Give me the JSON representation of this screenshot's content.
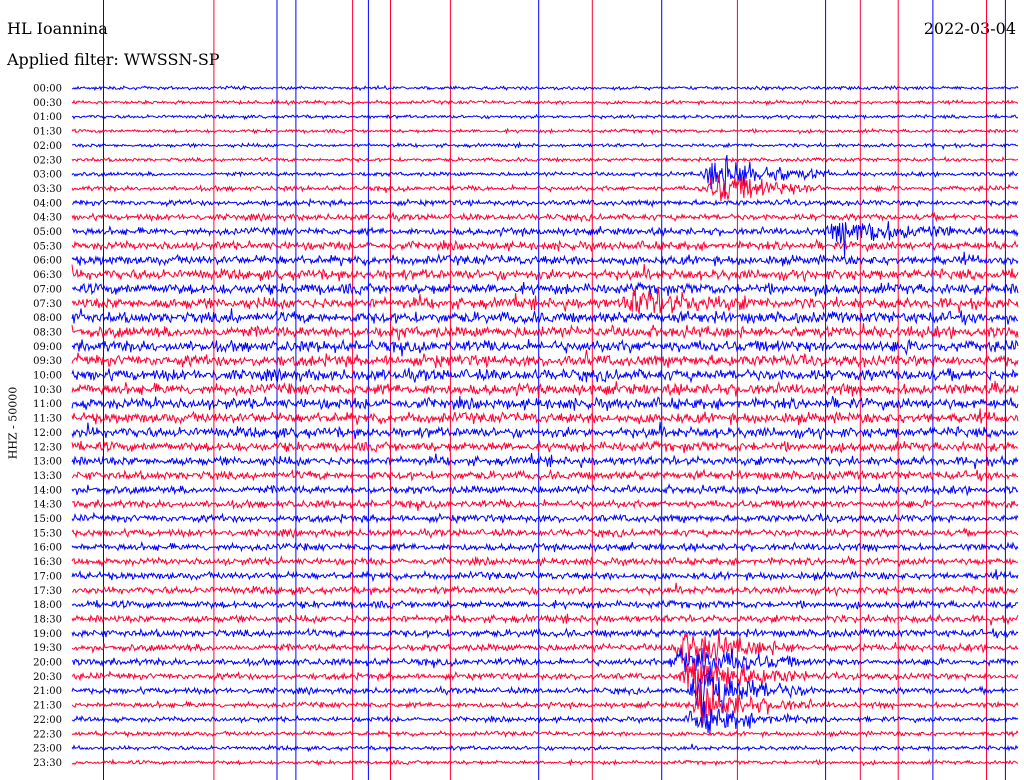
{
  "header": {
    "station": "HL Ioannina",
    "date": "2022-03-04",
    "filter": "Applied filter: WWSSN-SP"
  },
  "chart_data": {
    "type": "line",
    "title": "HL Ioannina",
    "subtitle": "Applied filter: WWSSN-SP",
    "ylabel": "HHZ - 50000",
    "xlabel": "",
    "row_labels": [
      "00:00",
      "00:30",
      "01:00",
      "01:30",
      "02:00",
      "02:30",
      "03:00",
      "03:30",
      "04:00",
      "04:30",
      "05:00",
      "05:30",
      "06:00",
      "06:30",
      "07:00",
      "07:30",
      "08:00",
      "08:30",
      "09:00",
      "09:30",
      "10:00",
      "10:30",
      "11:00",
      "11:30",
      "12:00",
      "12:30",
      "13:00",
      "13:30",
      "14:00",
      "14:30",
      "15:00",
      "15:30",
      "16:00",
      "16:30",
      "17:00",
      "17:30",
      "18:00",
      "18:30",
      "19:00",
      "19:30",
      "20:00",
      "20:30",
      "21:00",
      "21:30",
      "22:00",
      "22:30",
      "23:00",
      "23:30"
    ],
    "row_colors": [
      "#0000ff",
      "#ff0033"
    ],
    "minutes_per_row": 30,
    "amplitude_scale": 50000,
    "noise_level_by_row": [
      0.08,
      0.09,
      0.08,
      0.08,
      0.09,
      0.1,
      0.14,
      0.2,
      0.26,
      0.32,
      0.42,
      0.52,
      0.6,
      0.68,
      0.72,
      0.74,
      0.76,
      0.78,
      0.78,
      0.78,
      0.78,
      0.76,
      0.74,
      0.72,
      0.68,
      0.62,
      0.56,
      0.52,
      0.48,
      0.44,
      0.42,
      0.4,
      0.4,
      0.4,
      0.42,
      0.42,
      0.42,
      0.42,
      0.42,
      0.4,
      0.38,
      0.34,
      0.3,
      0.26,
      0.22,
      0.18,
      0.14,
      0.12
    ],
    "events": [
      {
        "row": "03:00",
        "minute": 20.5,
        "amplitude": 1.6
      },
      {
        "row": "03:30",
        "minute": 20.5,
        "amplitude": 1.2
      },
      {
        "row": "05:00",
        "minute": 24.5,
        "amplitude": 1.2
      },
      {
        "row": "07:30",
        "minute": 18.0,
        "amplitude": 1.0
      },
      {
        "row": "19:30",
        "minute": 19.5,
        "amplitude": 1.4
      },
      {
        "row": "20:00",
        "minute": 19.5,
        "amplitude": 1.6
      },
      {
        "row": "20:30",
        "minute": 19.8,
        "amplitude": 1.6
      },
      {
        "row": "21:00",
        "minute": 20.0,
        "amplitude": 1.8
      },
      {
        "row": "21:30",
        "minute": 20.0,
        "amplitude": 1.2
      },
      {
        "row": "22:00",
        "minute": 20.0,
        "amplitude": 1.0
      }
    ],
    "spikes": [
      {
        "minute": 1.0,
        "color": "#0000ff"
      },
      {
        "minute": 4.5,
        "color": "#ff0033"
      },
      {
        "minute": 6.5,
        "color": "#0000ff"
      },
      {
        "minute": 7.1,
        "color": "#0000ff"
      },
      {
        "minute": 8.9,
        "color": "#ff0033"
      },
      {
        "minute": 9.4,
        "color": "#0000ff"
      },
      {
        "minute": 10.1,
        "color": "#ff0033"
      },
      {
        "minute": 12.0,
        "color": "#ff0033"
      },
      {
        "minute": 14.8,
        "color": "#0000ff"
      },
      {
        "minute": 16.5,
        "color": "#ff0033"
      },
      {
        "minute": 18.7,
        "color": "#0000ff"
      },
      {
        "minute": 21.1,
        "color": "#ff0033"
      },
      {
        "minute": 23.9,
        "color": "#0000ff"
      },
      {
        "minute": 25.0,
        "color": "#ff0033"
      },
      {
        "minute": 26.2,
        "color": "#ff0033"
      },
      {
        "minute": 27.3,
        "color": "#0000ff"
      },
      {
        "minute": 29.0,
        "color": "#ff0033"
      },
      {
        "minute": 29.6,
        "color": "#0000ff"
      }
    ]
  }
}
